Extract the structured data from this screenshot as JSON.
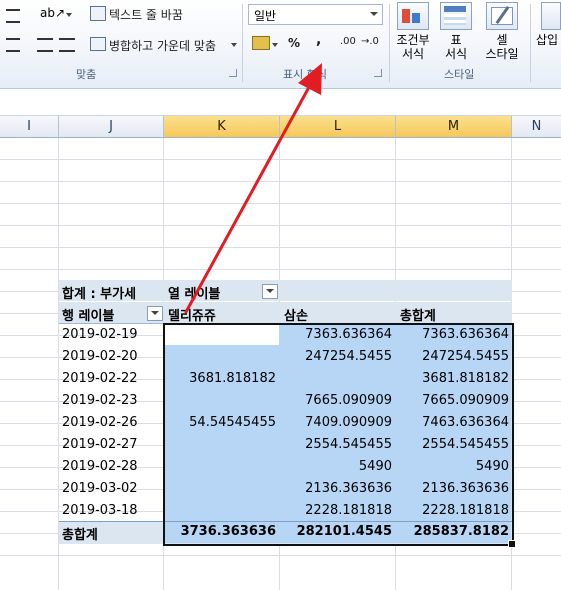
{
  "ribbon": {
    "wrap_text": "텍스트 줄 바꿈",
    "merge_center": "병합하고 가운데 맞춤",
    "group_alignment": "맞춤",
    "number_format_value": "일반",
    "percent": "%",
    "comma": ",",
    "increase_decimal": ".00",
    "decrease_decimal": "→.0",
    "group_number": "표시 형식",
    "conditional_format_line1": "조건부",
    "conditional_format_line2": "서식",
    "format_table_line1": "표",
    "format_table_line2": "서식",
    "cell_styles_line1": "셀",
    "cell_styles_line2": "스타일",
    "group_styles": "스타일",
    "insert": "삽입"
  },
  "columns": [
    "I",
    "J",
    "K",
    "L",
    "M",
    "N"
  ],
  "pivot": {
    "corner_label": "합계 : 부가세",
    "col_labels_header": "열 레이블",
    "row_labels_header": "행 레이블",
    "col_headers": [
      "델리쥬쥬",
      "삼손",
      "총합계"
    ],
    "rows": [
      {
        "date": "2019-02-19",
        "k": "",
        "l": "7363.636364",
        "m": "7363.636364"
      },
      {
        "date": "2019-02-20",
        "k": "",
        "l": "247254.5455",
        "m": "247254.5455"
      },
      {
        "date": "2019-02-22",
        "k": "3681.818182",
        "l": "",
        "m": "3681.818182"
      },
      {
        "date": "2019-02-23",
        "k": "",
        "l": "7665.090909",
        "m": "7665.090909"
      },
      {
        "date": "2019-02-26",
        "k": "54.54545455",
        "l": "7409.090909",
        "m": "7463.636364"
      },
      {
        "date": "2019-02-27",
        "k": "",
        "l": "2554.545455",
        "m": "2554.545455"
      },
      {
        "date": "2019-02-28",
        "k": "",
        "l": "5490",
        "m": "5490"
      },
      {
        "date": "2019-03-02",
        "k": "",
        "l": "2136.363636",
        "m": "2136.363636"
      },
      {
        "date": "2019-03-18",
        "k": "",
        "l": "2228.181818",
        "m": "2228.181818"
      }
    ],
    "total_label": "총합계",
    "totals": {
      "k": "3736.363636",
      "l": "282101.4545",
      "m": "285837.8182"
    }
  },
  "colors": {
    "selection": "#b7d6f6",
    "pivot_header": "#dce6f1",
    "annotation_arrow": "#e31b23",
    "active_column_header": "#f6c85a"
  }
}
